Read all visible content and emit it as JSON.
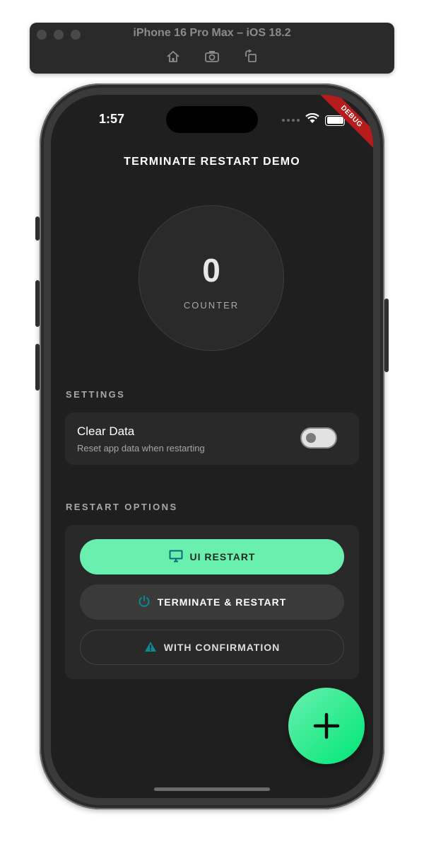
{
  "simulator": {
    "title": "iPhone 16 Pro Max – iOS 18.2",
    "toolbar_icons": [
      "home-icon",
      "screenshot-icon",
      "rotate-icon"
    ]
  },
  "status_bar": {
    "time": "1:57",
    "icons": [
      "signal-dots-icon",
      "wifi-icon",
      "battery-icon"
    ]
  },
  "debug_banner": "DEBUG",
  "app": {
    "title": "TERMINATE RESTART DEMO",
    "counter": {
      "value": "0",
      "label": "COUNTER"
    },
    "settings": {
      "section_label": "SETTINGS",
      "clear_data": {
        "title": "Clear Data",
        "subtitle": "Reset app data when restarting",
        "enabled": false
      }
    },
    "restart_options": {
      "section_label": "RESTART OPTIONS",
      "buttons": [
        {
          "label": "UI RESTART",
          "icon": "monitor-icon"
        },
        {
          "label": "TERMINATE & RESTART",
          "icon": "power-icon"
        },
        {
          "label": "WITH CONFIRMATION",
          "icon": "warning-icon"
        }
      ]
    },
    "fab": {
      "icon": "plus-icon"
    }
  },
  "colors": {
    "accent": "#69f0ae",
    "accent_dark": "#00e676",
    "background": "#1f1f1f",
    "card": "#292929",
    "icon_teal": "#0b6b73",
    "debug": "#b71c1c"
  }
}
